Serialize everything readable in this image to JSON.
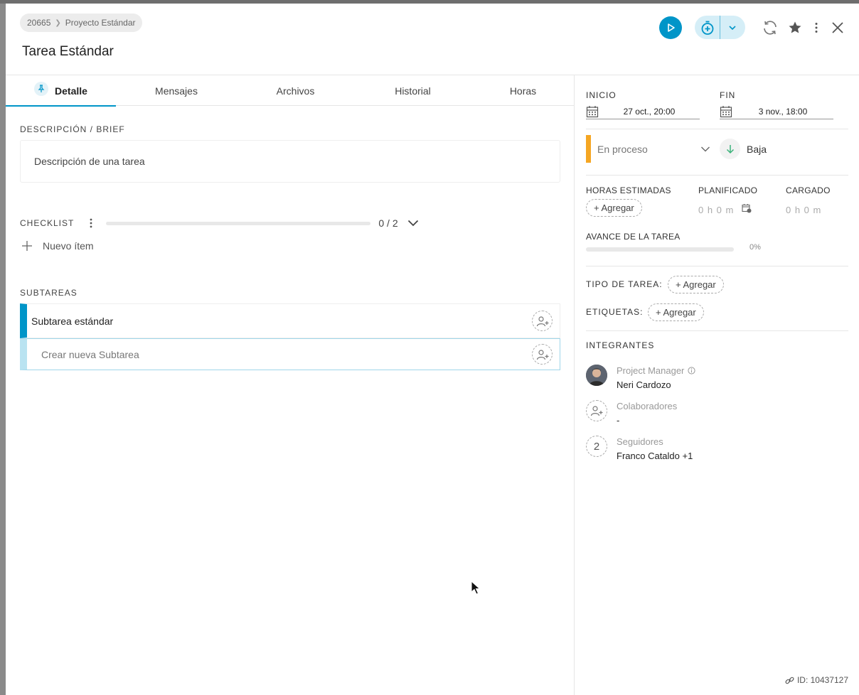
{
  "breadcrumb": {
    "project_id": "20665",
    "project_name": "Proyecto Estándar"
  },
  "task": {
    "title": "Tarea Estándar",
    "id_label": "ID: 10437127"
  },
  "colors": {
    "accent": "#0095c8",
    "status_in_progress": "#f5a623",
    "timer_bg": "#d5eef7"
  },
  "tabs": [
    {
      "label": "Detalle",
      "active": true
    },
    {
      "label": "Mensajes"
    },
    {
      "label": "Archivos"
    },
    {
      "label": "Historial"
    },
    {
      "label": "Horas"
    }
  ],
  "detail": {
    "description_label": "DESCRIPCIÓN / BRIEF",
    "description_text": "Descripción de una tarea",
    "checklist_label": "CHECKLIST",
    "checklist_done": 0,
    "checklist_total": 2,
    "checklist_count": "0 / 2",
    "new_item_label": "Nuevo ítem",
    "subtasks_label": "SUBTAREAS",
    "subtasks": [
      {
        "title": "Subtarea estándar"
      }
    ],
    "new_subtask_placeholder": "Crear nueva Subtarea"
  },
  "sidebar": {
    "start_label": "INICIO",
    "start_value": "27 oct., 20:00",
    "end_label": "FIN",
    "end_value": "3 nov., 18:00",
    "status": "En proceso",
    "priority": "Baja",
    "est_hours_label": "HORAS ESTIMADAS",
    "add_label": "+ Agregar",
    "planned_label": "PLANIFICADO",
    "planned_value": "0 h 0 m",
    "logged_label": "CARGADO",
    "logged_value": "0 h 0 m",
    "progress_label": "AVANCE DE LA TAREA",
    "progress_percent": 0,
    "progress_text": "0%",
    "task_type_label": "TIPO DE TAREA:",
    "tags_label": "ETIQUETAS:",
    "members_label": "INTEGRANTES",
    "pm_role": "Project Manager",
    "pm_name": "Neri Cardozo",
    "collab_role": "Colaboradores",
    "collab_value": "-",
    "followers_role": "Seguidores",
    "followers_count": "2",
    "followers_value": "Franco Cataldo +1"
  },
  "icons": [
    "play-icon",
    "timer-add-icon",
    "chevron-down-icon",
    "refresh-icon",
    "star-icon",
    "more-vertical-icon",
    "close-icon",
    "pin-icon",
    "plus-icon",
    "user-add-icon",
    "calendar-icon",
    "arrow-down-icon",
    "calendar-clock-icon",
    "info-icon",
    "link-icon"
  ]
}
